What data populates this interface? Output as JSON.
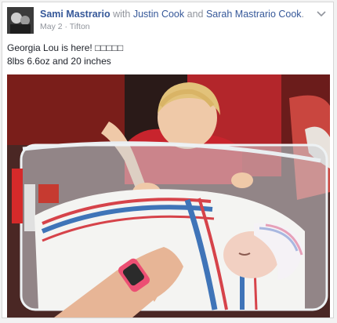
{
  "post": {
    "actor": "Sami Mastrario",
    "with_text": "with",
    "tagged_1": "Justin Cook",
    "and_text": "and",
    "tagged_2": "Sarah Mastrario Cook",
    "period": ".",
    "date": "May 2",
    "separator": "·",
    "location": "Tifton",
    "line1": "Georgia Lou is here! □□□□□",
    "line2": "8lbs 6.6oz and 20 inches"
  },
  "icons": {
    "options": "chevron-down-icon",
    "privacy": "globe-icon"
  },
  "colors": {
    "link": "#365899",
    "meta": "#90949c"
  }
}
